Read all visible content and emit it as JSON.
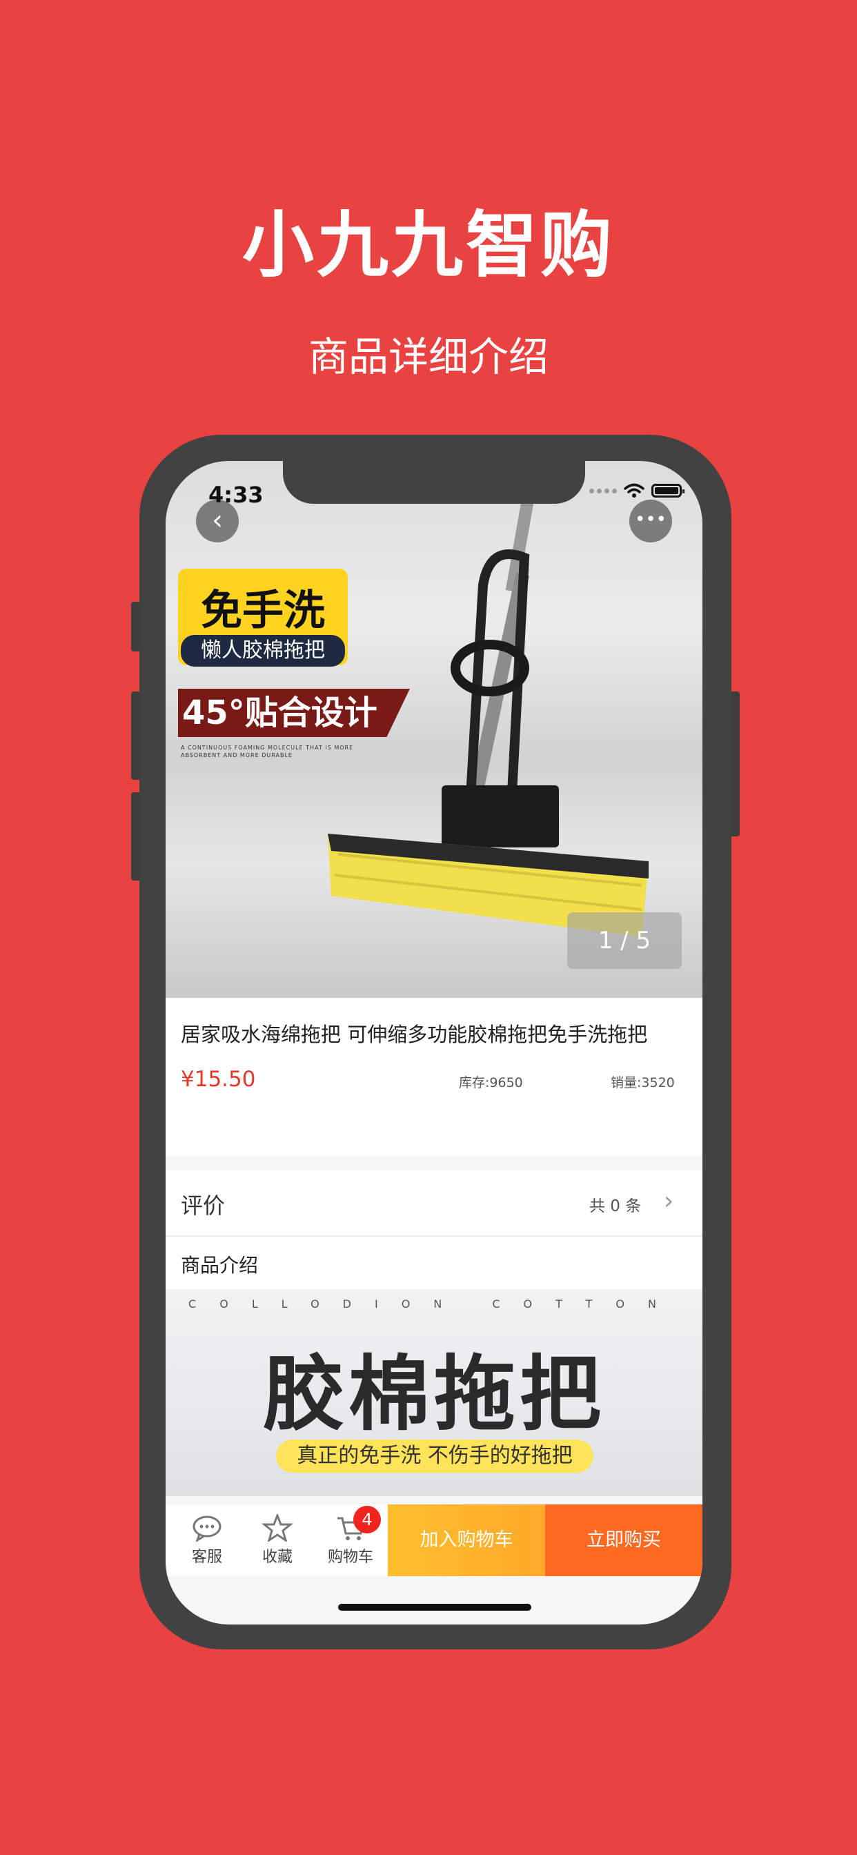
{
  "promo": {
    "title": "小九九智购",
    "subtitle": "商品详细介绍"
  },
  "status_bar": {
    "time": "4:33"
  },
  "hero": {
    "badge_main": "免手洗",
    "badge_sub": "懒人胶棉拖把",
    "banner_text": "45°贴合设计",
    "small_text": "A CONTINUOUS FOAMING MOLECULE THAT IS MORE ABSORBENT AND MORE DURABLE",
    "page_indicator": "1 / 5"
  },
  "product": {
    "title": "居家吸水海绵拖把 可伸缩多功能胶棉拖把免手洗拖把",
    "price": "¥15.50",
    "stock": "库存:9650",
    "sales": "销量:3520"
  },
  "review": {
    "label": "评价",
    "count": "共 0 条"
  },
  "intro": {
    "label": "商品介绍",
    "image_eng": "COLLODION COTTON",
    "image_title": "胶棉拖把",
    "image_slogan": "真正的免手洗 不伤手的好拖把"
  },
  "bottom_bar": {
    "service_label": "客服",
    "favorite_label": "收藏",
    "cart_label": "购物车",
    "cart_count": "4",
    "add_to_cart": "加入购物车",
    "buy_now": "立即购买"
  },
  "colors": {
    "background": "#e84241",
    "price": "#e43a2c",
    "add_to_cart": "#ffb42c",
    "buy_now": "#ff6a22"
  }
}
